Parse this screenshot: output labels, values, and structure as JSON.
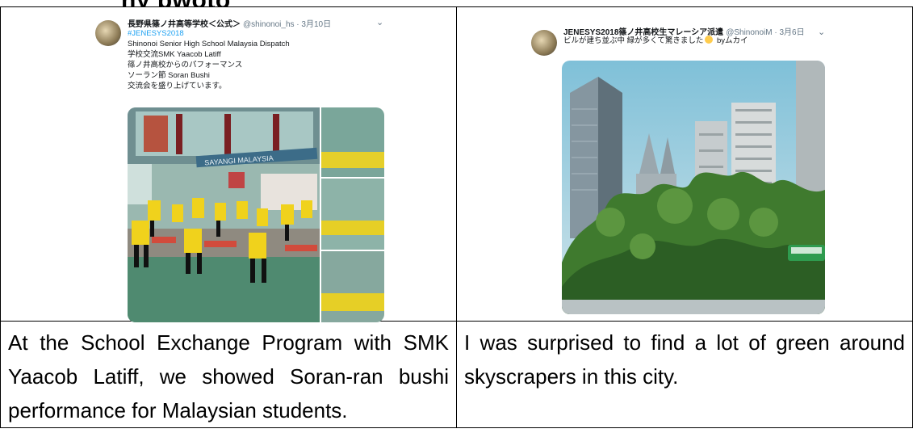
{
  "top_title_fragment": "hy pwoto",
  "left": {
    "tweet": {
      "name": "長野県篠ノ井高等学校＜公式＞",
      "handle": "@shinonoi_hs · 3月10日",
      "lines": [
        "#JENESYS2018",
        "Shinonoi Senior High School Malaysia Dispatch",
        "学校交流SMK Yaacob Latiff",
        "篠ノ井高校からのパフォーマンス",
        "ソーラン節 Soran Bushi",
        "交流会を盛り上げています。"
      ],
      "banner_text": "SAYANGI MALAYSIA"
    },
    "caption": "At the School Exchange Program with SMK Yaacob Latiff, we showed Soran-ran bushi performance for Malaysian students."
  },
  "right": {
    "tweet": {
      "name": "JENESYS2018篠ノ井高校生マレーシア派遣",
      "handle": "@ShinonoiM · 3月6日",
      "line_before_emoji": "ビルが建ち並ぶ中 緑が多くて驚きました",
      "line_after_emoji": " byムカイ"
    },
    "caption": "I was surprised to find a lot of green around skyscrapers in this city."
  },
  "colors": {
    "link": "#1da1f2",
    "border": "#000000"
  }
}
